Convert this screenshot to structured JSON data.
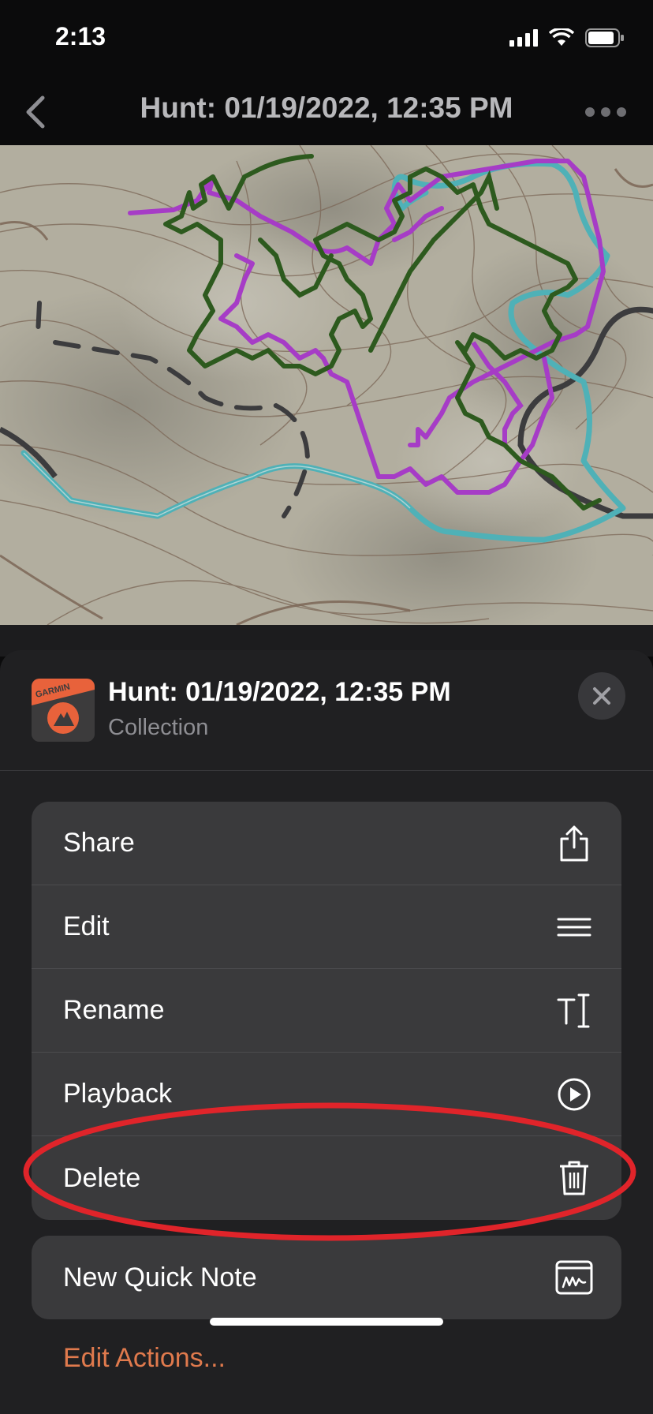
{
  "status_bar": {
    "time": "2:13"
  },
  "nav": {
    "title": "Hunt: 01/19/2022, 12:35 PM"
  },
  "sheet": {
    "title": "Hunt: 01/19/2022, 12:35 PM",
    "subtitle": "Collection",
    "app_icon_text": "GARMIN"
  },
  "menu": {
    "share": "Share",
    "edit": "Edit",
    "rename": "Rename",
    "playback": "Playback",
    "delete": "Delete",
    "new_quick_note": "New Quick Note"
  },
  "edit_actions": "Edit Actions...",
  "colors": {
    "track_green": "#2d5a1e",
    "track_purple": "#a63cc6",
    "track_teal": "#4fb1b7",
    "accent_orange": "#e07a4d",
    "highlight_red": "#e0242a"
  }
}
